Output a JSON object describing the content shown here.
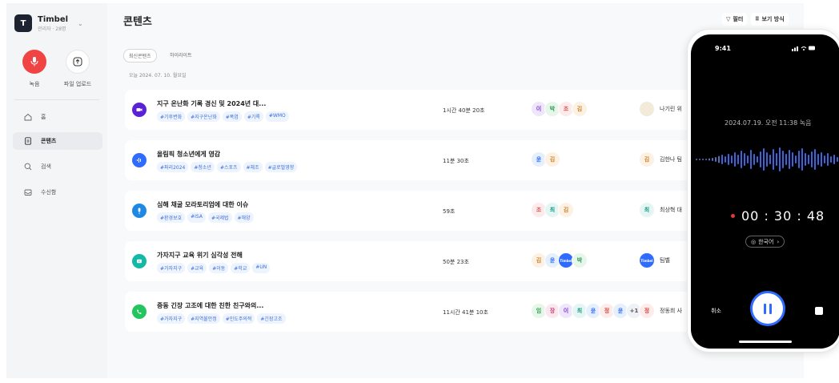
{
  "workspace": {
    "logo": "T",
    "name": "Timbel",
    "sub": "관리자 · 28명"
  },
  "actions": {
    "record": "녹음",
    "upload": "파일 업로드"
  },
  "nav": [
    {
      "label": "홈",
      "icon": "home-icon"
    },
    {
      "label": "콘텐츠",
      "icon": "document-icon"
    },
    {
      "label": "검색",
      "icon": "search-icon"
    },
    {
      "label": "수신함",
      "icon": "inbox-icon"
    }
  ],
  "page": {
    "title": "콘텐츠",
    "filter": "필터",
    "view": "보기 방식"
  },
  "chips": [
    "최신콘텐츠",
    "하이라이트"
  ],
  "date_label": "오늘 2024. 07. 10. 월요일",
  "colors": {
    "accent": "#2f6bff",
    "record": "#ef4443",
    "tag_text": "#3d6fd7"
  },
  "rows": [
    {
      "title": "지구 온난화 기록 경신 및 2024년 대...",
      "tags": [
        "#기후변화",
        "#지구온난화",
        "#폭염",
        "#기록",
        "#WMO"
      ],
      "duration": "1시간 40분 20초",
      "avatars": [
        "이",
        "박",
        "조",
        "김"
      ],
      "owner_initial": "",
      "owner": "나기린 위",
      "icon_color": "#5b21d6"
    },
    {
      "title": "올림픽 청소년에게 영감",
      "tags": [
        "#파리2024",
        "#청소년",
        "#스포츠",
        "#체조",
        "#글로벌영향"
      ],
      "duration": "11분 30초",
      "avatars": [
        "윤",
        "김"
      ],
      "owner_initial": "김",
      "owner": "김한나 팀",
      "icon_color": "#2f6bff"
    },
    {
      "title": "심해 채굴 모라토리엄에 대한 이슈",
      "tags": [
        "#환경보호",
        "#ISA",
        "#국제법",
        "#해양"
      ],
      "duration": "59초",
      "avatars": [
        "조",
        "최",
        "김"
      ],
      "owner_initial": "최",
      "owner": "최상혁 대",
      "icon_color": "#1e88e5"
    },
    {
      "title": "가자지구 교육 위기 심각성 전해",
      "tags": [
        "#가자지구",
        "#교육",
        "#이동",
        "#학교",
        "#UN"
      ],
      "duration": "50분 23초",
      "avatars": [
        "김",
        "윤",
        "Timbel",
        "박"
      ],
      "owner_initial": "Timbel",
      "owner": "팀벨",
      "icon_color": "#14b8a6"
    },
    {
      "title": "중동 긴장 고조에 대한 친한 친구와의...",
      "tags": [
        "#가자지구",
        "#지역불안정",
        "#인도주의적",
        "#긴장고조"
      ],
      "duration": "11시간 41분 10초",
      "avatars": [
        "임",
        "장",
        "이",
        "최",
        "윤",
        "정",
        "윤",
        "+1"
      ],
      "owner_initial": "정",
      "owner": "정동희 사",
      "icon_color": "#22c55e"
    }
  ],
  "phone": {
    "time": "9:41",
    "date": "2024.07.19. 오전 11:38 녹음",
    "timer": "00 : 30 : 48",
    "language": "한국어",
    "cancel": "취소"
  }
}
